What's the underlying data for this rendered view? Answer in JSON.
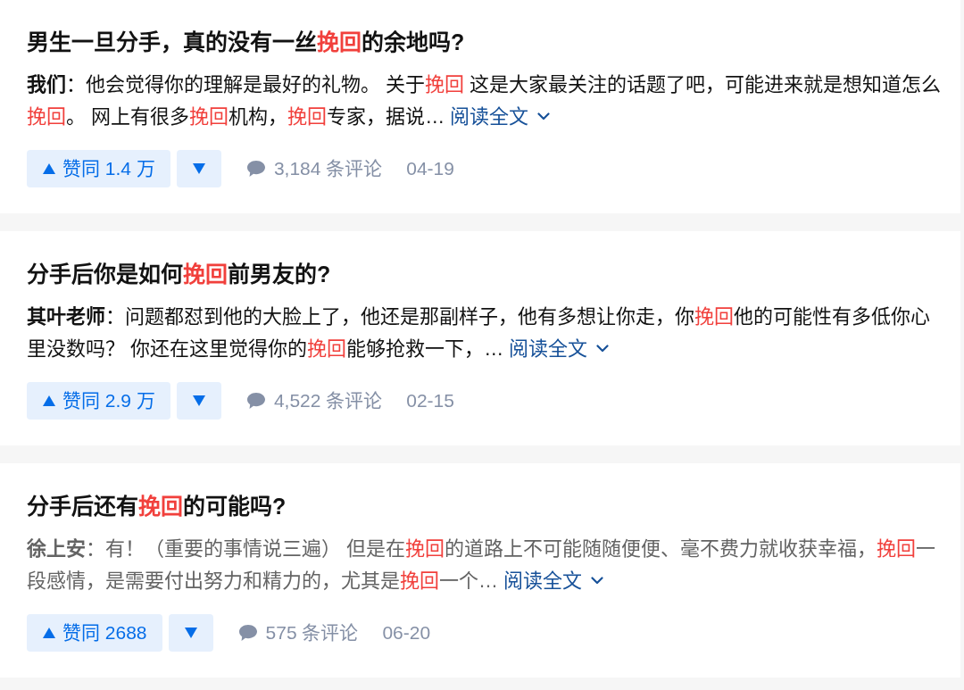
{
  "answers": [
    {
      "title": [
        {
          "text": "男生一旦分手，真的没有一丝",
          "highlight": false
        },
        {
          "text": "挽回",
          "highlight": true
        },
        {
          "text": "的余地吗?",
          "highlight": false
        }
      ],
      "author": "我们",
      "read": false,
      "excerpt": [
        {
          "text": "：他会觉得你的理解是最好的礼物。 关于",
          "highlight": false
        },
        {
          "text": "挽回",
          "highlight": true
        },
        {
          "text": " 这是大家最关注的话题了吧，可能进来就是想知道怎么",
          "highlight": false
        },
        {
          "text": "挽回",
          "highlight": true
        },
        {
          "text": "。 网上有很多",
          "highlight": false
        },
        {
          "text": "挽回",
          "highlight": true
        },
        {
          "text": "机构，",
          "highlight": false
        },
        {
          "text": "挽回",
          "highlight": true
        },
        {
          "text": "专家，据说…",
          "highlight": false
        }
      ],
      "read_more": "阅读全文",
      "upvote": "赞同 1.4 万",
      "comments": "3,184 条评论",
      "date": "04-19"
    },
    {
      "title": [
        {
          "text": "分手后你是如何",
          "highlight": false
        },
        {
          "text": "挽回",
          "highlight": true
        },
        {
          "text": "前男友的?",
          "highlight": false
        }
      ],
      "author": "其叶老师",
      "read": false,
      "excerpt": [
        {
          "text": "：问题都怼到他的大脸上了，他还是那副样子，他有多想让你走，你",
          "highlight": false
        },
        {
          "text": "挽回",
          "highlight": true
        },
        {
          "text": "他的可能性有多低你心里没数吗？ 你还在这里觉得你的",
          "highlight": false
        },
        {
          "text": "挽回",
          "highlight": true
        },
        {
          "text": "能够抢救一下，…",
          "highlight": false
        }
      ],
      "read_more": "阅读全文",
      "upvote": "赞同 2.9 万",
      "comments": "4,522 条评论",
      "date": "02-15"
    },
    {
      "title": [
        {
          "text": "分手后还有",
          "highlight": false
        },
        {
          "text": "挽回",
          "highlight": true
        },
        {
          "text": "的可能吗?",
          "highlight": false
        }
      ],
      "author": "徐上安",
      "read": true,
      "excerpt": [
        {
          "text": "：有！（重要的事情说三遍） 但是在",
          "highlight": false
        },
        {
          "text": "挽回",
          "highlight": true
        },
        {
          "text": "的道路上不可能随随便便、毫不费力就收获幸福，",
          "highlight": false
        },
        {
          "text": "挽回",
          "highlight": true
        },
        {
          "text": "一段感情，是需要付出努力和精力的，尤其是",
          "highlight": false
        },
        {
          "text": "挽回",
          "highlight": true
        },
        {
          "text": "一个…",
          "highlight": false
        }
      ],
      "read_more": "阅读全文",
      "upvote": "赞同 2688",
      "comments": "575 条评论",
      "date": "06-20"
    }
  ]
}
